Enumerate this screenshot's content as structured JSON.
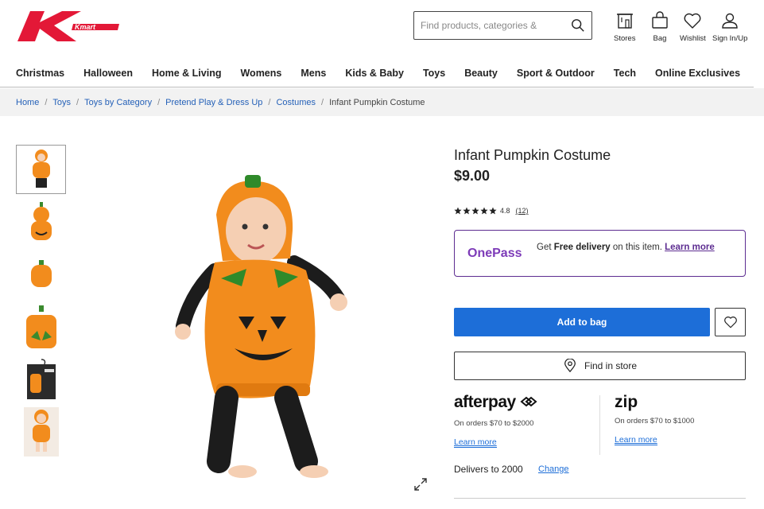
{
  "brand": {
    "logo_text": "Kmart",
    "color": "#e31837"
  },
  "search": {
    "placeholder": "Find products, categories &"
  },
  "header_icons": [
    {
      "label": "Stores",
      "icon": "store-icon"
    },
    {
      "label": "Bag",
      "icon": "bag-icon"
    },
    {
      "label": "Wishlist",
      "icon": "heart-icon"
    },
    {
      "label": "Sign In/Up",
      "icon": "user-icon"
    }
  ],
  "nav": [
    "Christmas",
    "Halloween",
    "Home & Living",
    "Womens",
    "Mens",
    "Kids & Baby",
    "Toys",
    "Beauty",
    "Sport & Outdoor",
    "Tech",
    "Online Exclusives"
  ],
  "breadcrumb": {
    "links": [
      "Home",
      "Toys",
      "Toys by Category",
      "Pretend Play & Dress Up",
      "Costumes"
    ],
    "current": "Infant Pumpkin Costume"
  },
  "product": {
    "title": "Infant Pumpkin Costume",
    "price": "$9.00",
    "rating": "4.8",
    "stars": 5,
    "reviews": "(12)"
  },
  "onepass": {
    "logo": "OnePass",
    "text_pre": "Get ",
    "text_bold": "Free delivery",
    "text_post": " on this item. ",
    "link": "Learn more"
  },
  "actions": {
    "add_to_bag": "Add to bag",
    "find_in_store": "Find in store"
  },
  "payments": {
    "afterpay": {
      "logo": "afterpay",
      "sub": "On orders $70 to $2000",
      "link": "Learn more"
    },
    "zip": {
      "logo": "zip",
      "sub": "On orders $70 to $1000",
      "link": "Learn more"
    }
  },
  "delivery": {
    "text": "Delivers to 2000",
    "change": "Change"
  },
  "colors": {
    "accent_blue": "#1d6ed8",
    "onepass_purple": "#5d2d91",
    "pumpkin": "#f28c1d"
  }
}
